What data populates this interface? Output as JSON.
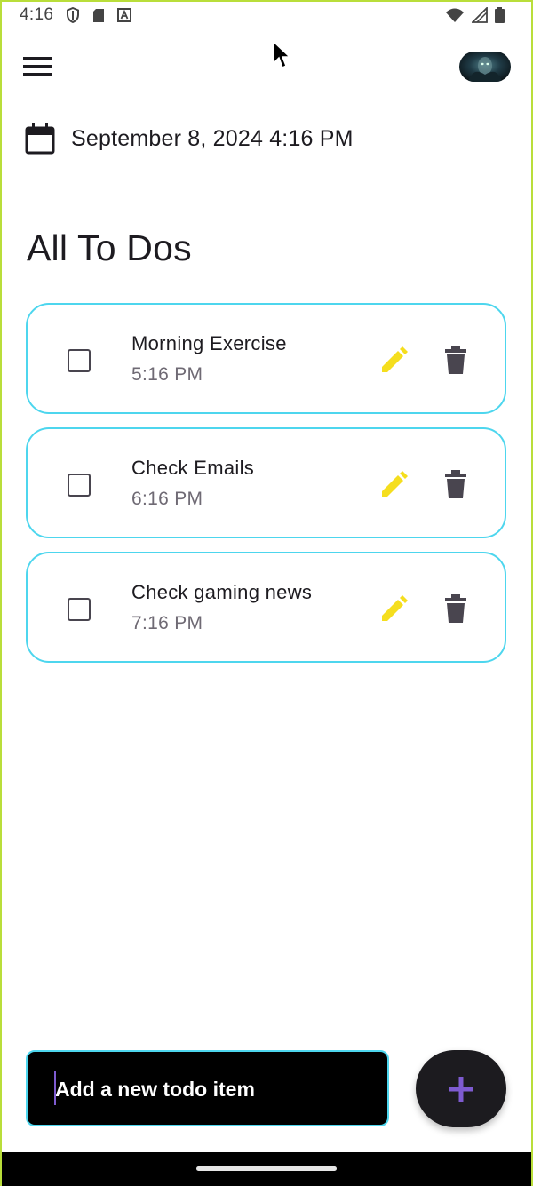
{
  "status_bar": {
    "time": "4:16",
    "left_icons": [
      "shield-icon",
      "sd-card-icon",
      "a-box-icon"
    ],
    "right_icons": [
      "wifi-icon",
      "signal-icon",
      "battery-icon"
    ]
  },
  "app_bar": {
    "menu_icon": "hamburger-menu-icon",
    "avatar": "profile-avatar"
  },
  "date_row": {
    "icon": "calendar-icon",
    "text": "September 8, 2024 4:16 PM"
  },
  "page_title": "All To Dos",
  "todos": [
    {
      "title": "Morning Exercise",
      "time": "5:16 PM",
      "checked": false
    },
    {
      "title": "Check Emails",
      "time": "6:16 PM",
      "checked": false
    },
    {
      "title": "Check gaming news",
      "time": "7:16 PM",
      "checked": false
    }
  ],
  "new_todo": {
    "placeholder": "Add a new todo item",
    "value": ""
  },
  "fab": {
    "icon": "plus-icon"
  },
  "colors": {
    "card_border": "#4dd6ee",
    "edit_icon": "#f5de1e",
    "delete_icon": "#49454f",
    "fab_bg": "#1c1b1f",
    "fab_icon": "#7e5bd0",
    "input_bg": "#000000"
  }
}
